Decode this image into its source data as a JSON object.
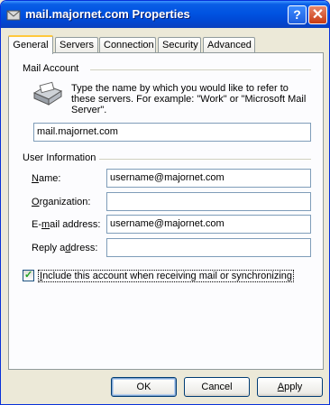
{
  "window": {
    "title": "mail.majornet.com Properties"
  },
  "tabs": [
    "General",
    "Servers",
    "Connection",
    "Security",
    "Advanced"
  ],
  "mail_account": {
    "section": "Mail Account",
    "description": "Type the name by which you would like to refer to these servers.  For example: \"Work\" or \"Microsoft Mail Server\".",
    "name_value": "mail.majornet.com"
  },
  "user_info": {
    "section": "User Information",
    "name_label_pre": "",
    "name_label_u": "N",
    "name_label_post": "ame:",
    "name_value": "username@majornet.com",
    "org_label_pre": "",
    "org_label_u": "O",
    "org_label_post": "rganization:",
    "org_value": "",
    "email_label_pre": "E-",
    "email_label_u": "m",
    "email_label_post": "ail address:",
    "email_value": "username@majornet.com",
    "reply_label_pre": "Reply a",
    "reply_label_u": "d",
    "reply_label_post": "dress:",
    "reply_value": ""
  },
  "include": {
    "label_pre": "",
    "label_u": "I",
    "label_post": "nclude this account when receiving mail or synchronizing",
    "checked": true,
    "check_glyph": "✓"
  },
  "buttons": {
    "ok": "OK",
    "cancel": "Cancel",
    "apply_u": "A",
    "apply_post": "pply"
  },
  "title_buttons": {
    "help": "?",
    "close": "✕"
  }
}
